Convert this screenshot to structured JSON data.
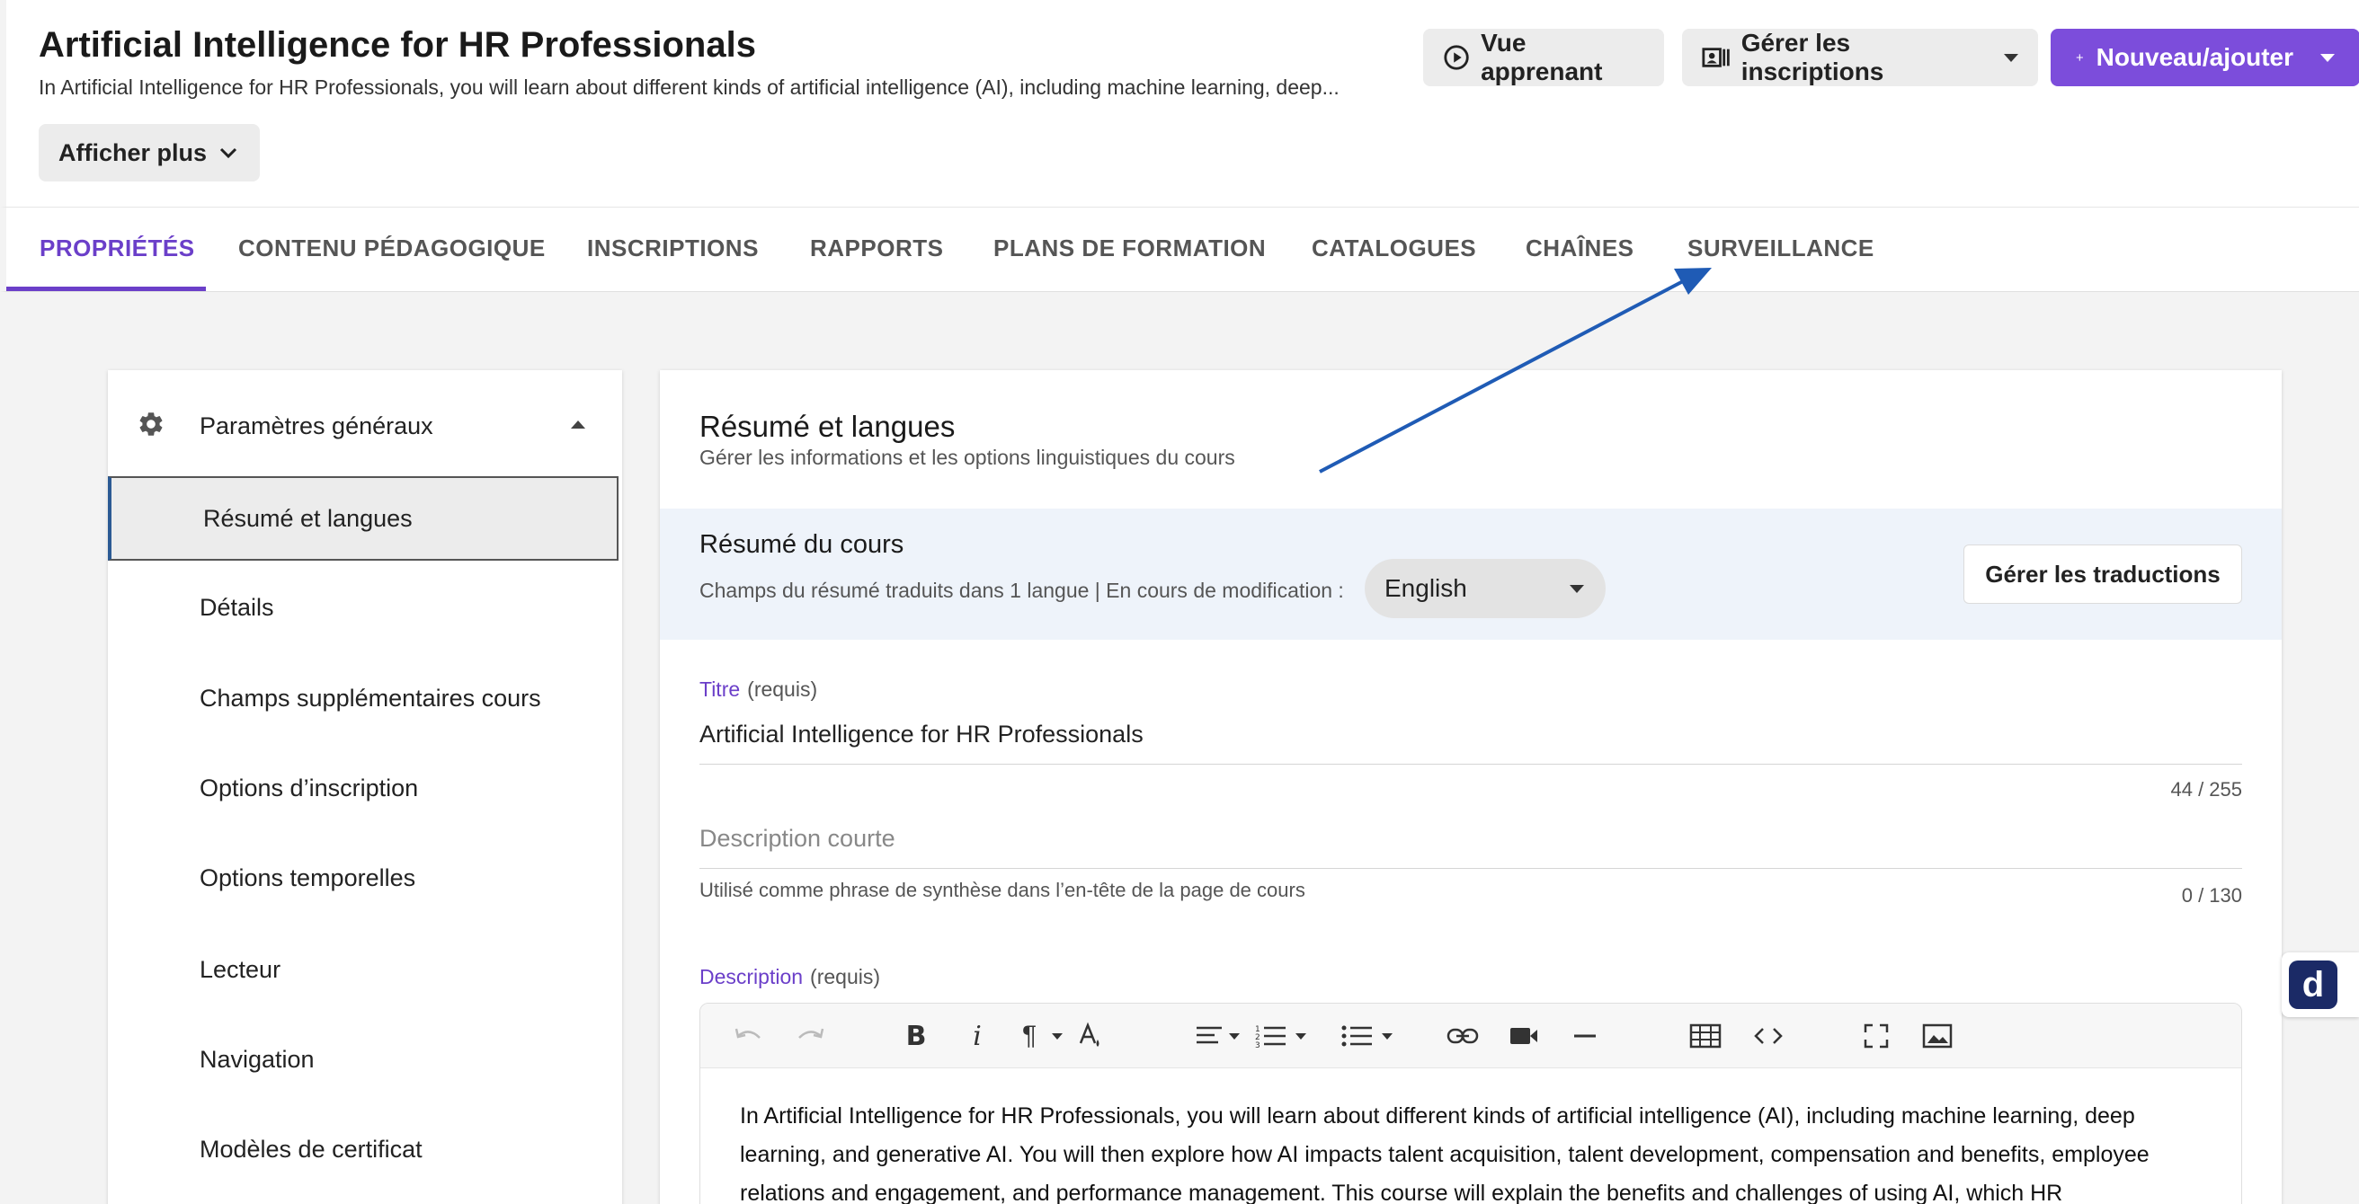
{
  "header": {
    "title": "Artificial Intelligence for HR Professionals",
    "subtitle": "In Artificial Intelligence for HR Professionals, you will learn about different kinds of artificial intelligence (AI), including machine learning, deep...",
    "show_more": "Afficher plus",
    "learner_view": "Vue apprenant",
    "manage_enrollments": "Gérer les inscriptions",
    "new_add": "Nouveau/ajouter"
  },
  "tabs": [
    "PROPRIÉTÉS",
    "CONTENU PÉDAGOGIQUE",
    "INSCRIPTIONS",
    "RAPPORTS",
    "PLANS DE FORMATION",
    "CATALOGUES",
    "CHAÎNES",
    "SURVEILLANCE"
  ],
  "sidebar": {
    "section_title": "Paramètres généraux",
    "items": [
      "Résumé et langues",
      "Détails",
      "Champs supplémentaires cours",
      "Options d’inscription",
      "Options temporelles",
      "Lecteur",
      "Navigation",
      "Modèles de certificat"
    ]
  },
  "main": {
    "title": "Résumé et langues",
    "subtitle": "Gérer les informations et les options linguistiques du cours",
    "summary": {
      "title": "Résumé du cours",
      "text": "Champs du résumé traduits dans 1 langue | En cours de modification :",
      "language": "English",
      "manage_translations": "Gérer les traductions"
    },
    "title_field": {
      "label": "Titre",
      "required": "(requis)",
      "value": "Artificial Intelligence for HR Professionals",
      "counter": "44 / 255"
    },
    "short_desc": {
      "placeholder": "Description courte",
      "helper": "Utilisé comme phrase de synthèse dans l’en-tête de la page de cours",
      "counter": "0 / 130"
    },
    "description": {
      "label": "Description",
      "required": "(requis)",
      "text": "In Artificial Intelligence for HR Professionals, you will learn about different kinds of artificial intelligence (AI), including machine learning, deep learning, and generative AI. You will then explore how AI impacts talent acquisition, talent development, compensation and benefits, employee relations and engagement, and performance management. This course will explain the benefits and challenges of using AI, which HR"
    }
  },
  "side_widget": {
    "letter": "d"
  },
  "colors": {
    "accent": "#6b3fc9",
    "primary_button": "#7c4ddb",
    "arrow": "#1f5bb5",
    "summary_band": "#eef3fa"
  },
  "icons": [
    "play-circle-icon",
    "enrollment-icon",
    "plus-icon",
    "chevron-down-icon",
    "gear-icon",
    "undo-icon",
    "redo-icon",
    "bold-icon",
    "italic-icon",
    "paragraph-icon",
    "text-color-icon",
    "align-icon",
    "ordered-list-icon",
    "bullet-list-icon",
    "link-icon",
    "video-icon",
    "horizontal-rule-icon",
    "table-icon",
    "code-icon",
    "fullscreen-icon",
    "image-icon"
  ]
}
